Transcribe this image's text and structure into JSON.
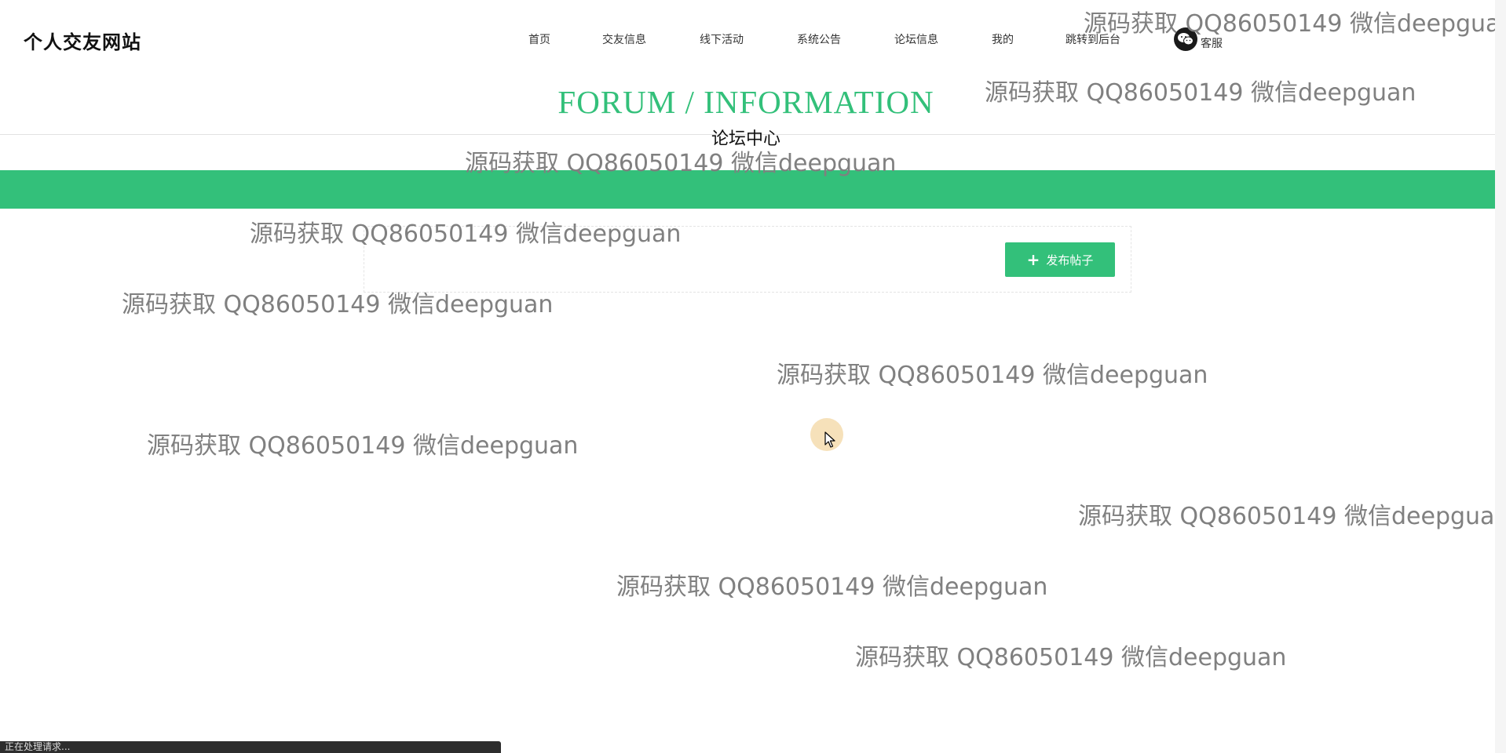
{
  "header": {
    "logo": "个人交友网站",
    "nav": [
      {
        "label": "首页"
      },
      {
        "label": "交友信息"
      },
      {
        "label": "线下活动"
      },
      {
        "label": "系统公告"
      },
      {
        "label": "论坛信息"
      },
      {
        "label": "我的"
      },
      {
        "label": "跳转到后台"
      }
    ],
    "service": {
      "label": "客服",
      "icon": "wechat-icon"
    }
  },
  "section": {
    "title": "FORUM / INFORMATION",
    "subtitle": "论坛中心"
  },
  "toolbar": {
    "publish_label": "发布帖子",
    "publish_icon": "plus-icon"
  },
  "watermark_text": "源码获取 QQ86050149 微信deepguan",
  "status_bar": {
    "text": "正在处理请求..."
  },
  "colors": {
    "accent": "#33c07a"
  }
}
